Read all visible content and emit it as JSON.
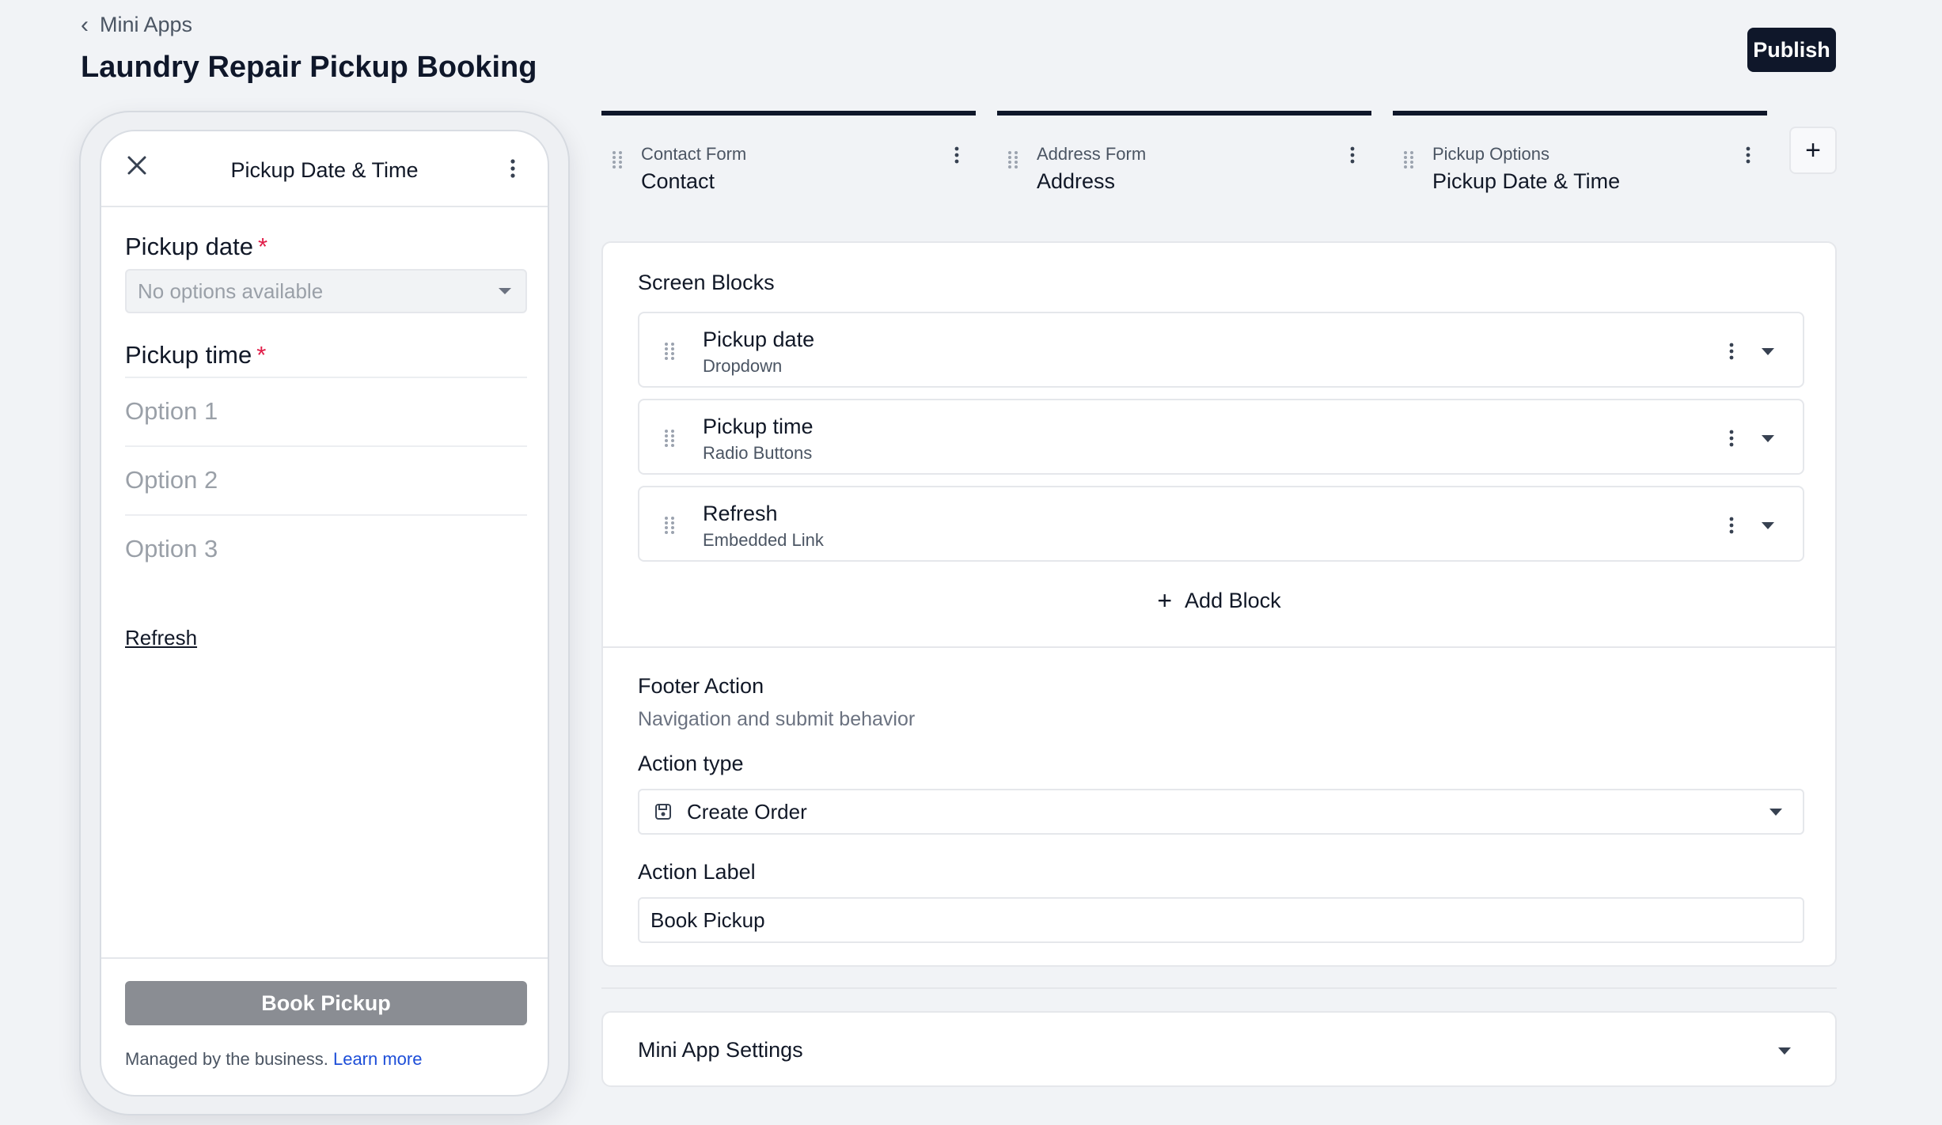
{
  "header": {
    "back_label": "Mini Apps",
    "title": "Laundry Repair Pickup Booking",
    "publish_label": "Publish"
  },
  "phone": {
    "title": "Pickup Date & Time",
    "pickup_date_label": "Pickup date",
    "required_mark": "*",
    "pickup_date_placeholder": "No options available",
    "pickup_time_label": "Pickup time",
    "options": [
      "Option 1",
      "Option 2",
      "Option 3"
    ],
    "refresh_label": "Refresh",
    "book_label": "Book Pickup",
    "managed_text": "Managed by the business.",
    "learn_more": "Learn more"
  },
  "tabs": [
    {
      "sub": "Contact Form",
      "main": "Contact"
    },
    {
      "sub": "Address Form",
      "main": "Address"
    },
    {
      "sub": "Pickup Options",
      "main": "Pickup Date & Time"
    }
  ],
  "add_screen_label": "+",
  "editor": {
    "screen_blocks_title": "Screen Blocks",
    "blocks": [
      {
        "name": "Pickup date",
        "type": "Dropdown"
      },
      {
        "name": "Pickup time",
        "type": "Radio Buttons"
      },
      {
        "name": "Refresh",
        "type": "Embedded Link"
      }
    ],
    "add_block_label": "Add Block",
    "footer_action_title": "Footer Action",
    "footer_action_desc": "Navigation and submit behavior",
    "action_type_label": "Action type",
    "action_type_value": "Create Order",
    "action_label_label": "Action Label",
    "action_label_value": "Book Pickup"
  },
  "settings": {
    "title": "Mini App Settings"
  },
  "colors": {
    "primary": "#0f172a",
    "required": "#e11d48",
    "link": "#1d4ed8",
    "disabled_button": "#8a8d93"
  }
}
